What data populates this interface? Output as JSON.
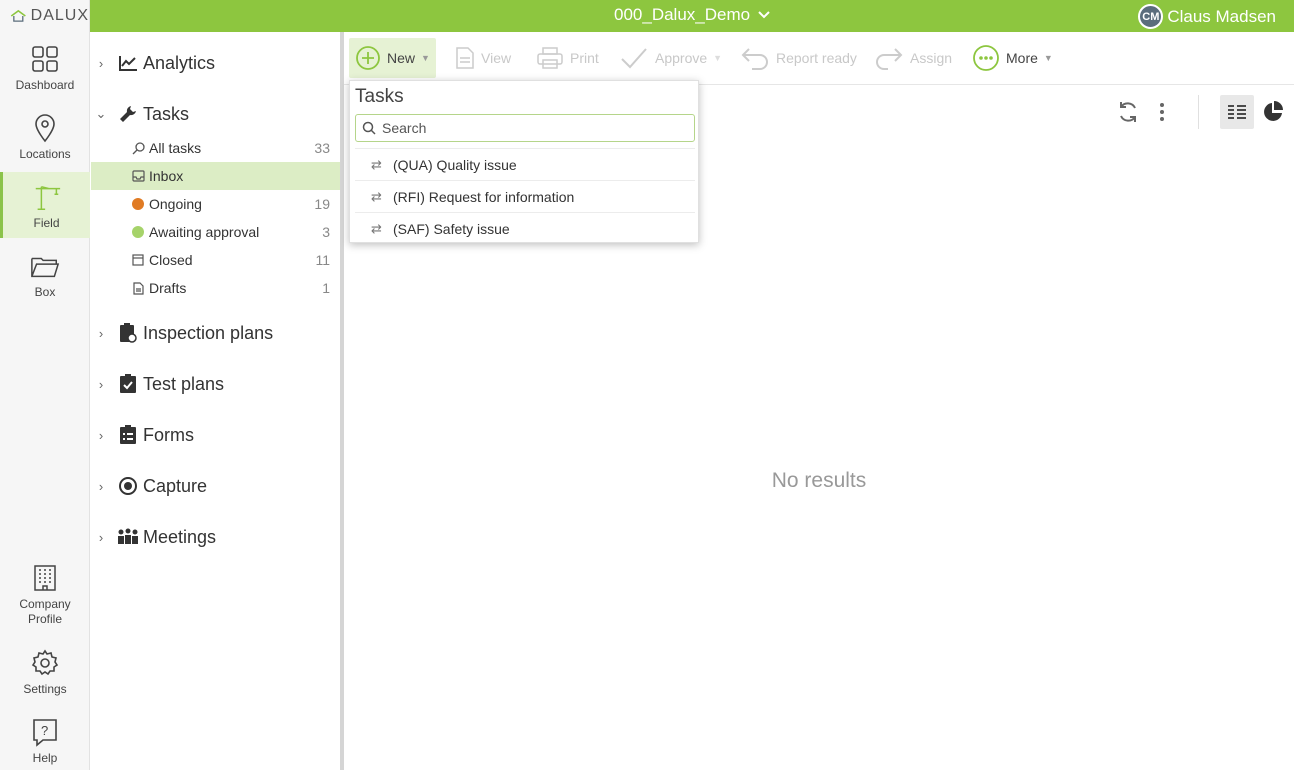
{
  "app": {
    "logo_text": "DALUX"
  },
  "topbar": {
    "project": "000_Dalux_Demo",
    "user_initials": "CM",
    "user_name": "Claus Madsen"
  },
  "rail": {
    "items": [
      {
        "label": "Dashboard"
      },
      {
        "label": "Locations"
      },
      {
        "label": "Field"
      },
      {
        "label": "Box"
      },
      {
        "label": "Company Profile"
      },
      {
        "label": "Settings"
      },
      {
        "label": "Help"
      }
    ]
  },
  "nav": {
    "analytics": "Analytics",
    "tasks": "Tasks",
    "subitems": [
      {
        "label": "All tasks",
        "count": "33"
      },
      {
        "label": "Inbox",
        "count": ""
      },
      {
        "label": "Ongoing",
        "count": "19"
      },
      {
        "label": "Awaiting approval",
        "count": "3"
      },
      {
        "label": "Closed",
        "count": "11"
      },
      {
        "label": "Drafts",
        "count": "1"
      }
    ],
    "inspection_plans": "Inspection plans",
    "test_plans": "Test plans",
    "forms": "Forms",
    "capture": "Capture",
    "meetings": "Meetings"
  },
  "toolbar": {
    "new": "New",
    "view": "View",
    "print": "Print",
    "approve": "Approve",
    "report_ready": "Report ready",
    "assign": "Assign",
    "more": "More"
  },
  "main": {
    "empty_text": "No results"
  },
  "dropdown": {
    "title": "Tasks",
    "search_placeholder": "Search",
    "items": [
      {
        "label": "(QUA) Quality issue"
      },
      {
        "label": "(RFI) Request for information"
      },
      {
        "label": "(SAF) Safety issue"
      }
    ]
  },
  "colors": {
    "brand_green": "#8dc63f",
    "active_bg": "#dcedc5",
    "ongoing": "#e07b24",
    "awaiting": "#a6d36a"
  }
}
